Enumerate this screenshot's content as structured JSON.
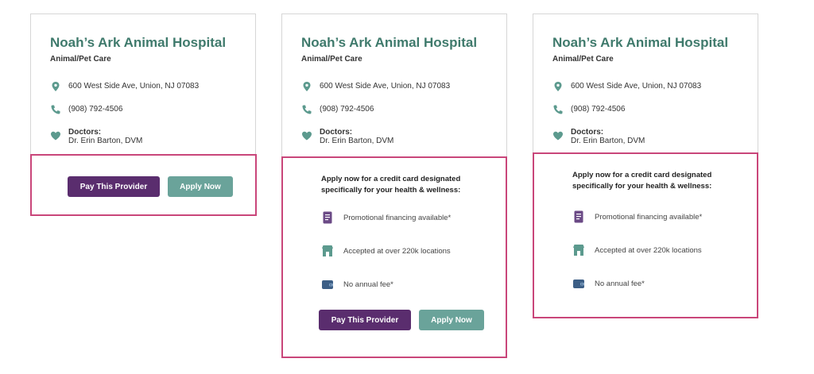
{
  "provider": {
    "name": "Noah’s Ark Animal Hospital",
    "category": "Animal/Pet Care",
    "address": "600 West Side Ave, Union, NJ 07083",
    "phone": "(908) 792-4506",
    "doctors_label": "Doctors:",
    "doctor": "Dr. Erin Barton, DVM"
  },
  "buttons": {
    "pay": "Pay This Provider",
    "apply": "Apply Now"
  },
  "credit": {
    "intro": "Apply now for a credit card designated specifically for your health & wellness:",
    "features": [
      "Promotional financing available*",
      "Accepted at over 220k locations",
      "No annual fee*"
    ]
  },
  "colors": {
    "title": "#3f7a6c",
    "pay_button": "#5a2d6e",
    "apply_button": "#6aa39a",
    "highlight_border": "#c9467a",
    "icon_green": "#5c9a8e",
    "icon_purple": "#6b4a86"
  }
}
